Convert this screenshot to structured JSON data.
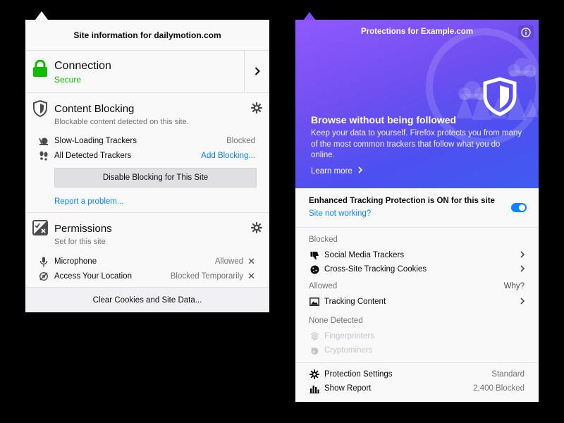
{
  "site_info": {
    "header": "Site information for dailymotion.com",
    "connection": {
      "title": "Connection",
      "status": "Secure"
    },
    "content_blocking": {
      "title": "Content Blocking",
      "subtitle": "Blockable content detected on this site.",
      "rows": [
        {
          "label": "Slow-Loading Trackers",
          "value": "Blocked"
        },
        {
          "label": "All Detected Trackers",
          "link": "Add Blocking..."
        }
      ],
      "disable_button": "Disable Blocking for This Site",
      "report_link": "Report a problem..."
    },
    "permissions": {
      "title": "Permissions",
      "subtitle": "Set for this site",
      "rows": [
        {
          "label": "Microphone",
          "value": "Allowed"
        },
        {
          "label": "Access Your Location",
          "value": "Blocked Temporarily"
        }
      ]
    },
    "clear_button": "Clear Cookies and Site Data..."
  },
  "protections": {
    "title": "Protections for Example.com",
    "hero": {
      "heading": "Browse without being followed",
      "body": "Keep your data to yourself. Firefox protects you from many of the most common trackers that follow what you do online.",
      "learn_more": "Learn more"
    },
    "etp": {
      "title": "Enhanced Tracking Protection is ON for this site",
      "link": "Site not working?",
      "enabled": true
    },
    "blocked_label": "Blocked",
    "blocked": [
      {
        "label": "Social Media Trackers",
        "icon": "thumbs-down-icon"
      },
      {
        "label": "Cross-Site Tracking Cookies",
        "icon": "cookie-icon"
      }
    ],
    "allowed_label": "Allowed",
    "why": "Why?",
    "allowed": [
      {
        "label": "Tracking Content",
        "icon": "image-icon"
      }
    ],
    "none_label": "None Detected",
    "none": [
      {
        "label": "Fingerprinters",
        "icon": "fingerprint-icon"
      },
      {
        "label": "Cryptominers",
        "icon": "cryptominer-icon"
      }
    ],
    "settings": {
      "label": "Protection Settings",
      "value": "Standard"
    },
    "report": {
      "label": "Show Report",
      "value": "2,400 Blocked"
    }
  },
  "colors": {
    "secure_green": "#12bc00",
    "link_blue": "#0a84ff",
    "hero_purple": "#9059ff",
    "hero_blue": "#3f5cf0"
  }
}
